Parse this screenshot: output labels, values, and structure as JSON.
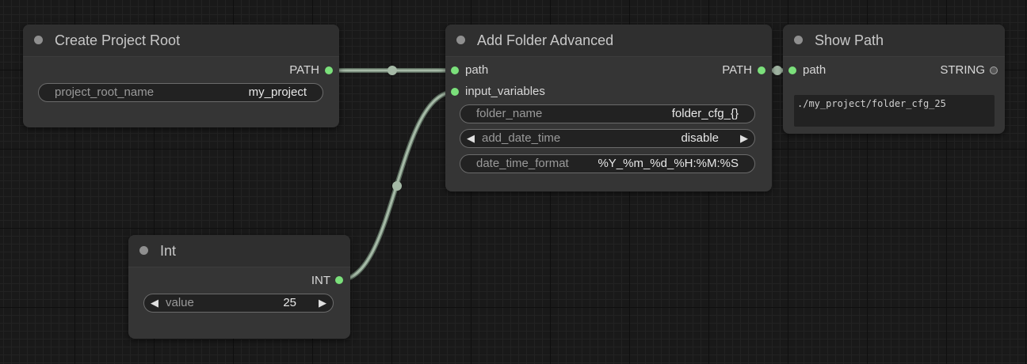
{
  "colors": {
    "canvas": "#191919",
    "node_body": "#353535",
    "node_header": "#2f2f2f",
    "link": "#9fb3a1",
    "slot_connected": "#7be07b",
    "slot_unconnected": "#555555"
  },
  "nodes": {
    "create_project_root": {
      "title": "Create Project Root",
      "output_label": "PATH",
      "widget_label": "project_root_name",
      "widget_value": "my_project"
    },
    "add_folder_advanced": {
      "title": "Add Folder Advanced",
      "input_path_label": "path",
      "input_variables_label": "input_variables",
      "output_label": "PATH",
      "widgets": {
        "folder_name": {
          "label": "folder_name",
          "value": "folder_cfg_{}"
        },
        "add_date_time": {
          "label": "add_date_time",
          "value": "disable"
        },
        "date_time_format": {
          "label": "date_time_format",
          "value": "%Y_%m_%d_%H:%M:%S"
        }
      }
    },
    "show_path": {
      "title": "Show Path",
      "input_label": "path",
      "output_label": "STRING",
      "display_text": "./my_project/folder_cfg_25"
    },
    "int": {
      "title": "Int",
      "output_label": "INT",
      "widget_label": "value",
      "widget_value": "25"
    }
  },
  "icons": {
    "arrow_left": "◀",
    "arrow_right": "▶"
  }
}
